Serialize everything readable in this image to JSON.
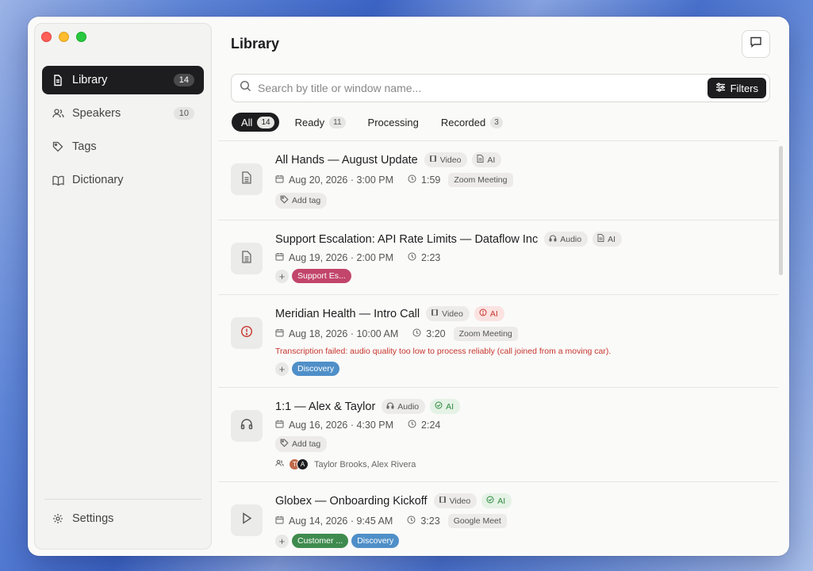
{
  "colors": {
    "accent": "#1d1d1f",
    "tag_support": "#c2456b",
    "tag_discovery": "#4f8fc8",
    "tag_customer": "#3f8b4e",
    "error": "#c8362d",
    "ai_ok": "#2f8a3e"
  },
  "sidebar": {
    "items": [
      {
        "label": "Library",
        "count": "14",
        "icon": "document-icon"
      },
      {
        "label": "Speakers",
        "count": "10",
        "icon": "people-icon"
      },
      {
        "label": "Tags",
        "icon": "tag-icon"
      },
      {
        "label": "Dictionary",
        "icon": "book-icon"
      }
    ],
    "settings_label": "Settings"
  },
  "header": {
    "title": "Library"
  },
  "search": {
    "placeholder": "Search by title or window name...",
    "filters_label": "Filters"
  },
  "tabs": [
    {
      "label": "All",
      "count": "14"
    },
    {
      "label": "Ready",
      "count": "11"
    },
    {
      "label": "Processing"
    },
    {
      "label": "Recorded",
      "count": "3"
    }
  ],
  "recordings": [
    {
      "title": "All Hands — August Update",
      "media": "Video",
      "ai": "AI",
      "date": "Aug 20, 2026 · 3:00 PM",
      "duration": "1:59",
      "source": "Zoom Meeting",
      "add_tag": "Add tag"
    },
    {
      "title": "Support Escalation: API Rate Limits — Dataflow Inc",
      "media": "Audio",
      "ai": "AI",
      "date": "Aug 19, 2026 · 2:00 PM",
      "duration": "2:23",
      "tags": [
        "Support Es..."
      ]
    },
    {
      "title": "Meridian Health — Intro Call",
      "media": "Video",
      "ai": "AI",
      "date": "Aug 18, 2026 · 10:00 AM",
      "duration": "3:20",
      "source": "Zoom Meeting",
      "error": "Transcription failed: audio quality too low to process reliably (call joined from a moving car).",
      "tags": [
        "Discovery"
      ]
    },
    {
      "title": "1:1 — Alex & Taylor",
      "media": "Audio",
      "ai": "AI",
      "date": "Aug 16, 2026 · 4:30 PM",
      "duration": "2:24",
      "add_tag": "Add tag",
      "speakers": "Taylor Brooks, Alex Rivera",
      "avatars": [
        "T",
        "A"
      ]
    },
    {
      "title": "Globex — Onboarding Kickoff",
      "media": "Video",
      "ai": "AI",
      "date": "Aug 14, 2026 · 9:45 AM",
      "duration": "3:23",
      "source": "Google Meet",
      "tags": [
        "Customer ...",
        "Discovery"
      ]
    }
  ]
}
